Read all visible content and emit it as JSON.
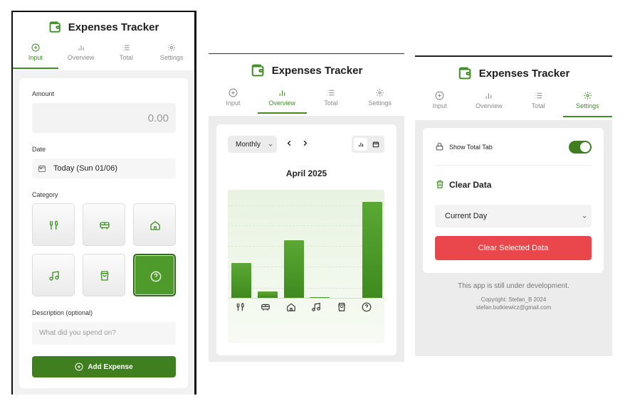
{
  "app": {
    "title": "Expenses Tracker",
    "accent": "#3f8f24",
    "danger": "#e9474b"
  },
  "tabs": [
    {
      "label": "Input",
      "icon": "plus-circle-icon"
    },
    {
      "label": "Overview",
      "icon": "bar-chart-icon"
    },
    {
      "label": "Total",
      "icon": "list-icon"
    },
    {
      "label": "Settings",
      "icon": "gear-icon"
    }
  ],
  "input_view": {
    "amount_label": "Amount",
    "amount_value": "0.00",
    "date_label": "Date",
    "date_value": "Today (Sun 01/06)",
    "category_label": "Category",
    "categories": [
      {
        "icon": "utensils-icon",
        "selected": false
      },
      {
        "icon": "bus-icon",
        "selected": false
      },
      {
        "icon": "home-icon",
        "selected": false
      },
      {
        "icon": "music-icon",
        "selected": false
      },
      {
        "icon": "shopping-bag-icon",
        "selected": false
      },
      {
        "icon": "question-icon",
        "selected": true
      }
    ],
    "description_label": "Description (optional)",
    "description_placeholder": "What did you spend on?",
    "add_button": "Add Expense"
  },
  "overview_view": {
    "period_select": "Monthly",
    "month_title": "April 2025"
  },
  "chart_data": {
    "type": "bar",
    "categories": [
      "utensils-icon",
      "bus-icon",
      "home-icon",
      "music-icon",
      "shopping-bag-icon",
      "question-icon"
    ],
    "values": [
      36,
      7,
      60,
      0.5,
      0,
      100
    ],
    "ylim": [
      0,
      110
    ],
    "title": "April 2025",
    "grid": true
  },
  "settings_view": {
    "show_total_label": "Show Total Tab",
    "show_total_on": true,
    "clear_title": "Clear Data",
    "clear_select": "Current Day",
    "clear_button": "Clear Selected Data",
    "dev_note": "This app is still under development.",
    "copyright": "Copyright: Stefan_B 2024",
    "email": "stefan.butkiewicz@gmail.com"
  }
}
